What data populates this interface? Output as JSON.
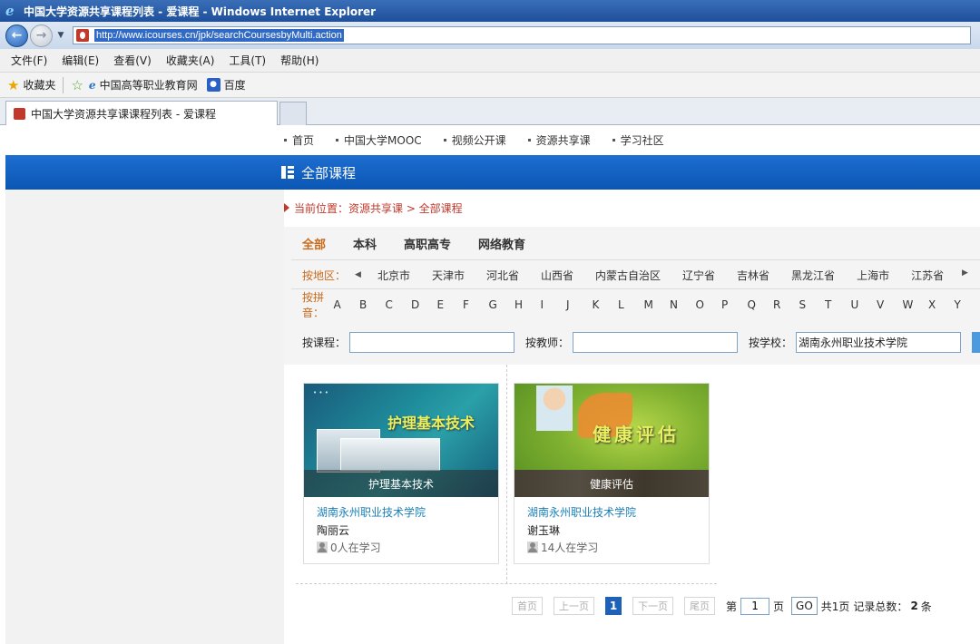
{
  "window": {
    "title": "中国大学资源共享课程列表 - 爱课程 - Windows Internet Explorer",
    "ie_logo": "e"
  },
  "address": {
    "url": "http://www.icourses.cn/jpk/searchCoursesbyMulti.action"
  },
  "menu": {
    "items": [
      "文件(F)",
      "编辑(E)",
      "查看(V)",
      "收藏夹(A)",
      "工具(T)",
      "帮助(H)"
    ]
  },
  "favorites": {
    "label": "收藏夹",
    "links": [
      "中国高等职业教育网",
      "百度"
    ]
  },
  "tab": {
    "label": "中国大学资源共享课课程列表 - 爱课程"
  },
  "site_nav": {
    "items": [
      "首页",
      "中国大学MOOC",
      "视频公开课",
      "资源共享课",
      "学习社区"
    ]
  },
  "section": {
    "title": "全部课程"
  },
  "breadcrumb": {
    "text": "当前位置：资源共享课 > 全部课程"
  },
  "categories": {
    "items": [
      "全部",
      "本科",
      "高职高专",
      "网络教育"
    ],
    "active_index": 0
  },
  "region": {
    "label": "按地区：",
    "items": [
      "北京市",
      "天津市",
      "河北省",
      "山西省",
      "内蒙古自治区",
      "辽宁省",
      "吉林省",
      "黑龙江省",
      "上海市",
      "江苏省"
    ]
  },
  "pinyin": {
    "label": "按拼音：",
    "letters": [
      "A",
      "B",
      "C",
      "D",
      "E",
      "F",
      "G",
      "H",
      "I",
      "J",
      "K",
      "L",
      "M",
      "N",
      "O",
      "P",
      "Q",
      "R",
      "S",
      "T",
      "U",
      "V",
      "W",
      "X",
      "Y"
    ]
  },
  "search": {
    "course_label": "按课程：",
    "course_value": "",
    "teacher_label": "按教师：",
    "teacher_value": "",
    "school_label": "按学校：",
    "school_value": "湖南永州职业技术学院"
  },
  "courses": [
    {
      "thumb_title": "护理基本技术",
      "caption": "护理基本技术",
      "school": "湖南永州职业技术学院",
      "teacher": "陶丽云",
      "learners": "0人在学习"
    },
    {
      "thumb_title": "健康评估",
      "caption": "健康评估",
      "school": "湖南永州职业技术学院",
      "teacher": "谢玉琳",
      "learners": "14人在学习"
    }
  ],
  "pager": {
    "first": "首页",
    "prev": "上一页",
    "current": "1",
    "next": "下一页",
    "last": "尾页",
    "page_prefix": "第",
    "page_input": "1",
    "page_suffix": "页",
    "go": "GO",
    "total_pages": "共1页",
    "total_label": "记录总数：",
    "total_count": "2",
    "total_unit": "条"
  },
  "colors": {
    "brand_blue": "#0b56b4",
    "accent_orange": "#c96a1a",
    "breadcrumb_red": "#c0392b",
    "link_blue": "#1a7fb5"
  }
}
